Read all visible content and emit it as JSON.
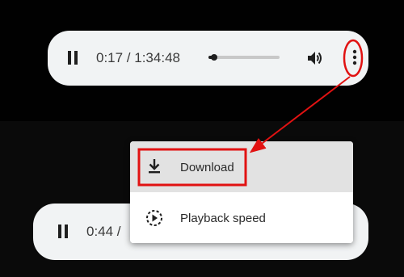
{
  "players": [
    {
      "state": "playing",
      "time_display": "0:17 / 1:34:48",
      "progress_fraction": 0.08,
      "controls": [
        "pause-icon",
        "volume-icon",
        "more-options-icon"
      ]
    },
    {
      "state": "playing",
      "time_display": "0:44 /",
      "controls": [
        "pause-icon"
      ]
    }
  ],
  "menu": {
    "items": [
      {
        "label": "Download",
        "icon": "download-icon",
        "highlighted": true
      },
      {
        "label": "Playback speed",
        "icon": "playback-speed-icon",
        "highlighted": false
      }
    ]
  },
  "annotation": {
    "color": "#e11212",
    "marks": [
      "circle-around-more-options",
      "arrow-to-download",
      "box-around-download"
    ]
  }
}
